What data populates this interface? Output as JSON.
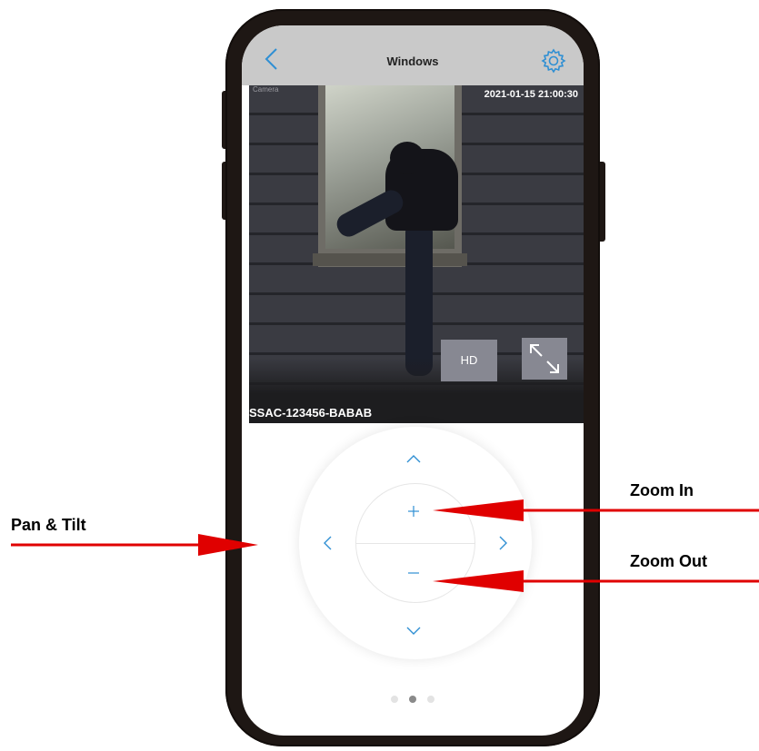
{
  "nav": {
    "title": "Windows",
    "back_icon": "chevron-left-icon",
    "settings_icon": "gear-icon"
  },
  "video": {
    "camera_label": "Camera",
    "timestamp": "2021-01-15 21:00:30",
    "hd_label": "HD",
    "fullscreen_icon": "expand-arrows-icon",
    "device_id": "SSAC-123456-BABAB"
  },
  "ptz": {
    "up_icon": "chevron-up-icon",
    "down_icon": "chevron-down-icon",
    "left_icon": "chevron-left-icon",
    "right_icon": "chevron-right-icon",
    "zoom_in_icon": "plus-icon",
    "zoom_out_icon": "minus-icon"
  },
  "pager": {
    "count": 3,
    "active_index": 1
  },
  "callouts": {
    "zoom_in": "Zoom In",
    "pan_tilt": "Pan & Tilt",
    "zoom_out": "Zoom Out"
  },
  "colors": {
    "accent": "#2f8fd3",
    "arrow": "#e00000",
    "navbar": "#c9c9c9",
    "phone_body": "#1e1714"
  }
}
